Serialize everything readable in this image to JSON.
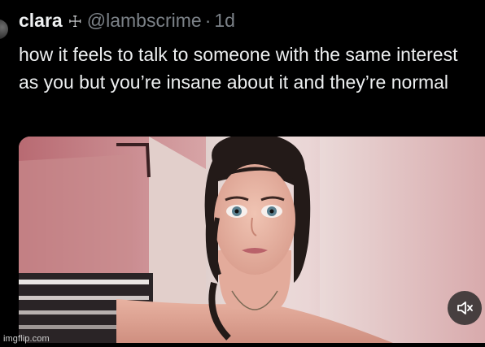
{
  "tweet": {
    "display_name": "clara",
    "name_symbol": "☩",
    "handle": "@lambscrime",
    "separator": "·",
    "time": "1d",
    "text": "how it feels to talk to someone with the same interest as you but you’re insane about it and they’re normal"
  },
  "media": {
    "type": "video",
    "control": "mute-icon"
  },
  "watermark": "imgflip.com",
  "colors": {
    "background": "#000000",
    "text": "#e7e9ea",
    "secondary_text": "#7c8288"
  }
}
